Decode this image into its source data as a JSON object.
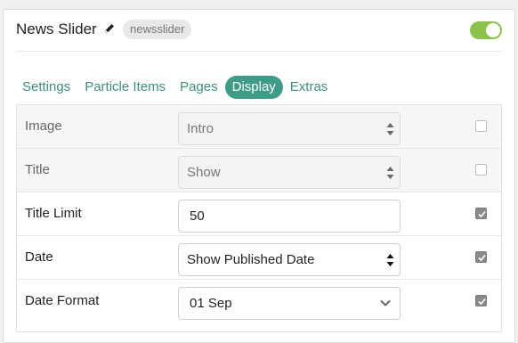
{
  "header": {
    "title": "News Slider",
    "badge": "newsslider",
    "enabled": true,
    "accent_color": "#8bc34a"
  },
  "tabs": [
    {
      "label": "Settings",
      "active": false
    },
    {
      "label": "Particle Items",
      "active": false
    },
    {
      "label": "Pages",
      "active": false
    },
    {
      "label": "Display",
      "active": true
    },
    {
      "label": "Extras",
      "active": false
    }
  ],
  "rows": [
    {
      "label": "Image",
      "value": "Intro",
      "control": "select",
      "checked": false,
      "disabled": true
    },
    {
      "label": "Title",
      "value": "Show",
      "control": "select",
      "checked": false,
      "disabled": true
    },
    {
      "label": "Title Limit",
      "value": "50",
      "control": "input",
      "checked": true,
      "disabled": false
    },
    {
      "label": "Date",
      "value": "Show Published Date",
      "control": "select",
      "checked": true,
      "disabled": false
    },
    {
      "label": "Date Format",
      "value": "01 Sep",
      "control": "dropdown",
      "checked": true,
      "disabled": false
    }
  ],
  "colors": {
    "tab_active_bg": "#3d9c86",
    "tab_text": "#3d8f7e"
  }
}
